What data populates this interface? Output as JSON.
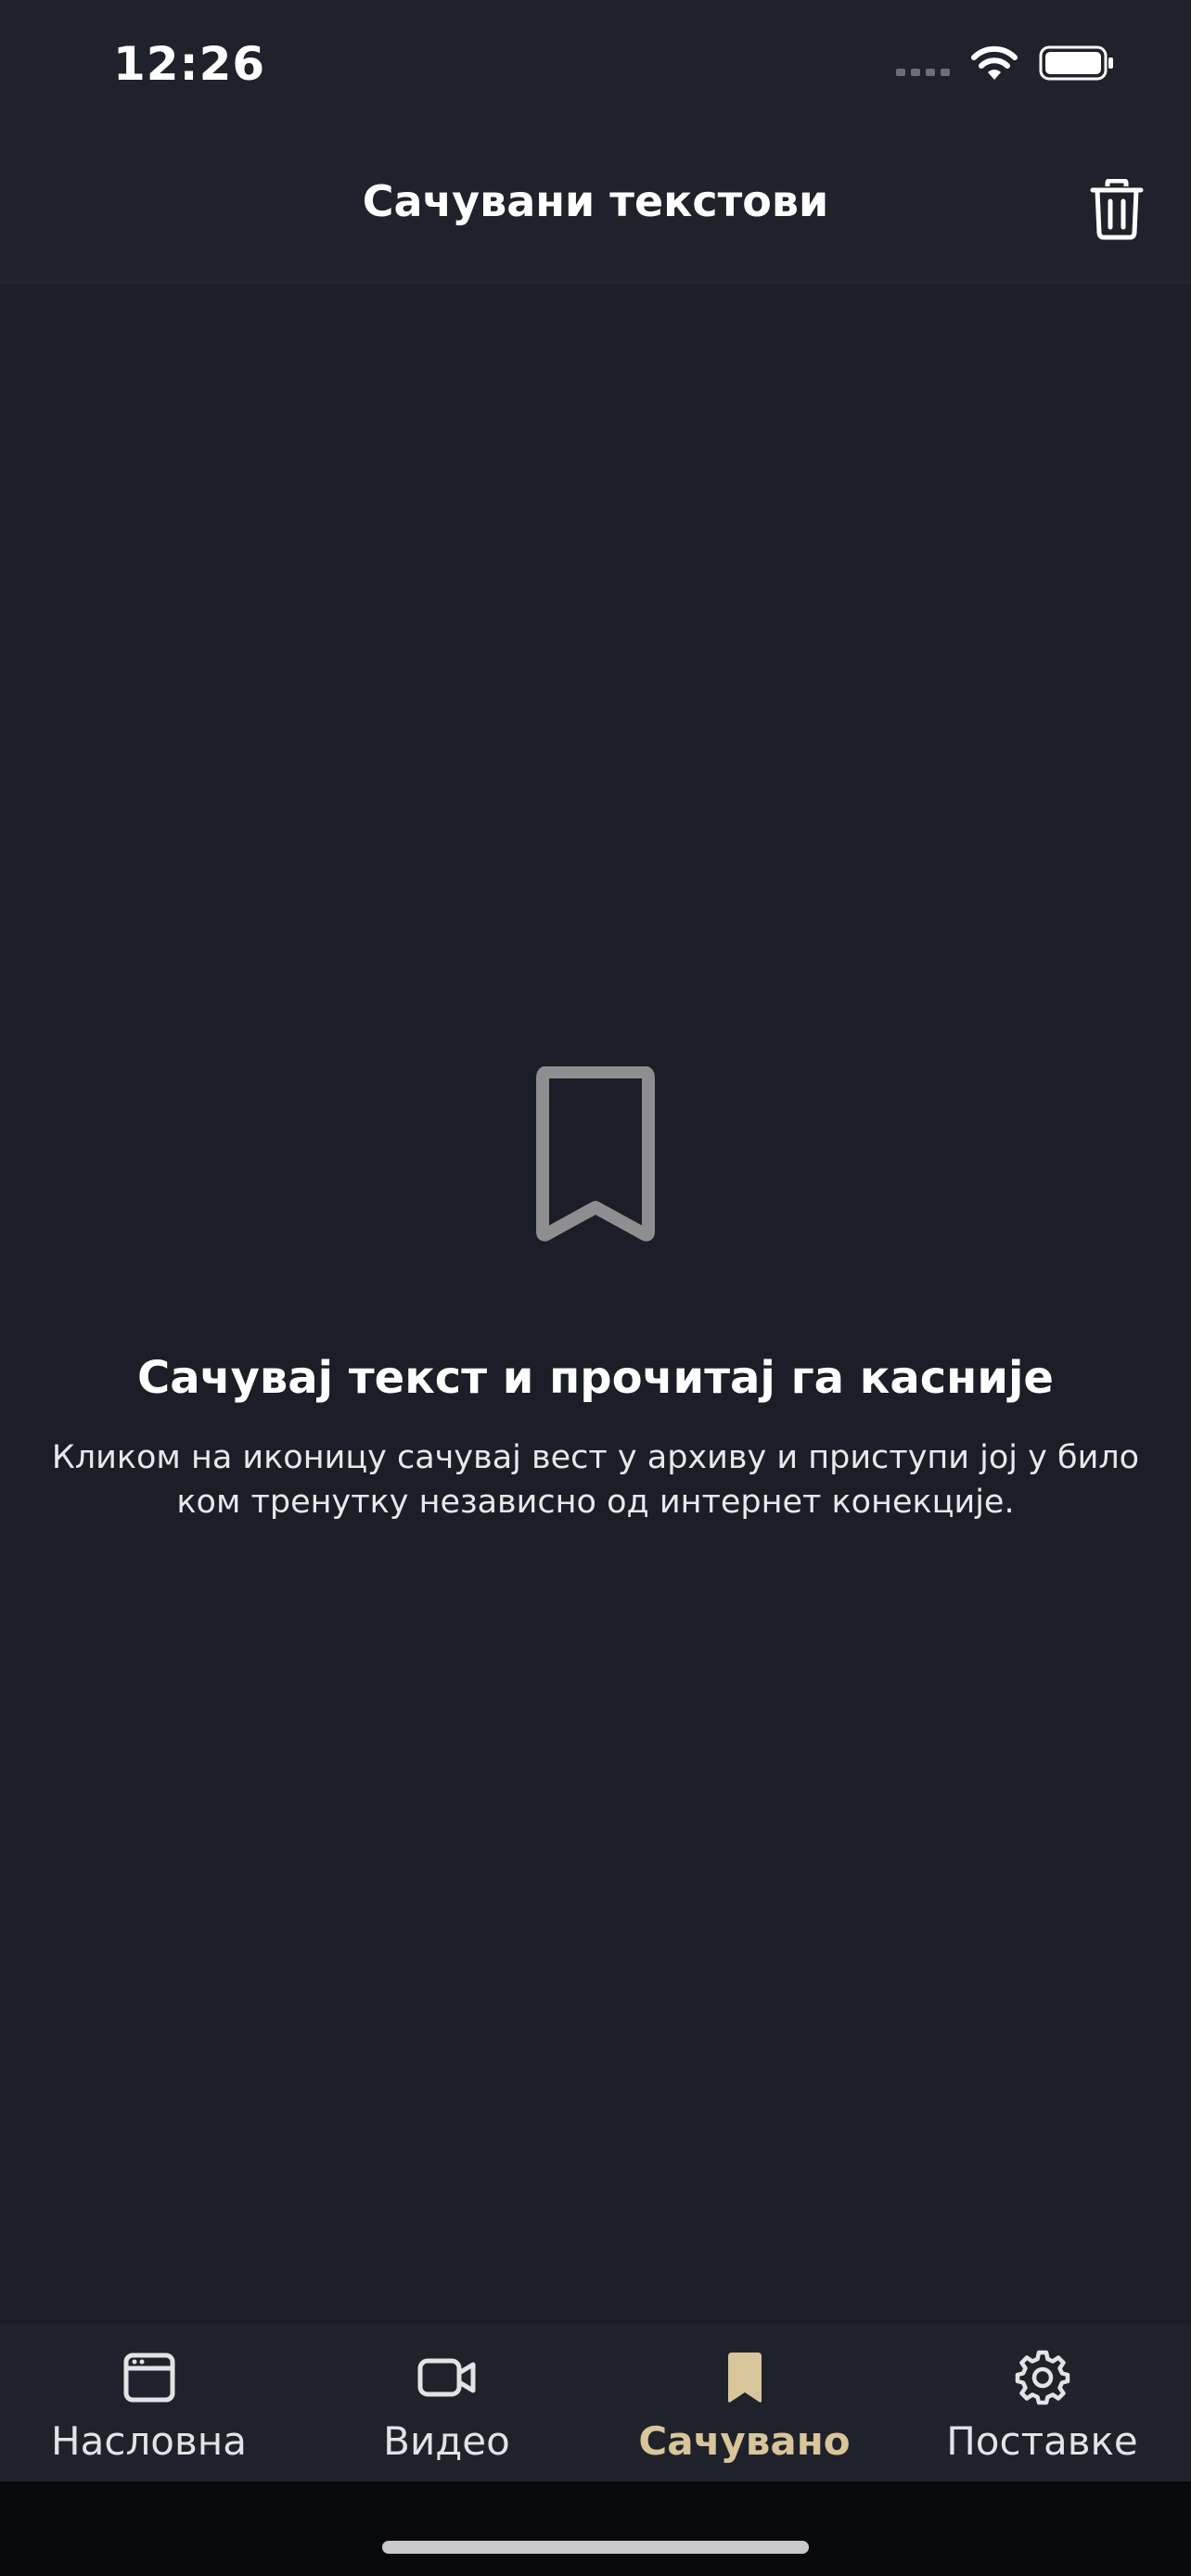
{
  "status_bar": {
    "time": "12:26"
  },
  "header": {
    "title": "Сачувани текстови",
    "trash_icon": "trash-icon"
  },
  "empty_state": {
    "icon": "bookmark-icon",
    "title": "Сачувај текст и прочитај га касније",
    "description": "Кликом на иконицу сачувај вест у архиву и приступи јој у било ком тренутку независно од интернет конекције."
  },
  "tab_bar": {
    "items": [
      {
        "label": "Насловна",
        "icon": "browser-window-icon",
        "active": false
      },
      {
        "label": "Видео",
        "icon": "video-camera-icon",
        "active": false
      },
      {
        "label": "Сачувано",
        "icon": "bookmark-icon",
        "active": true
      },
      {
        "label": "Поставке",
        "icon": "gear-icon",
        "active": false
      }
    ]
  },
  "colors": {
    "background": "#1b1e27",
    "bar_background": "#1f222b",
    "accent": "#d8c59a",
    "empty_icon": "#8e8e90",
    "text": "#ffffff"
  }
}
